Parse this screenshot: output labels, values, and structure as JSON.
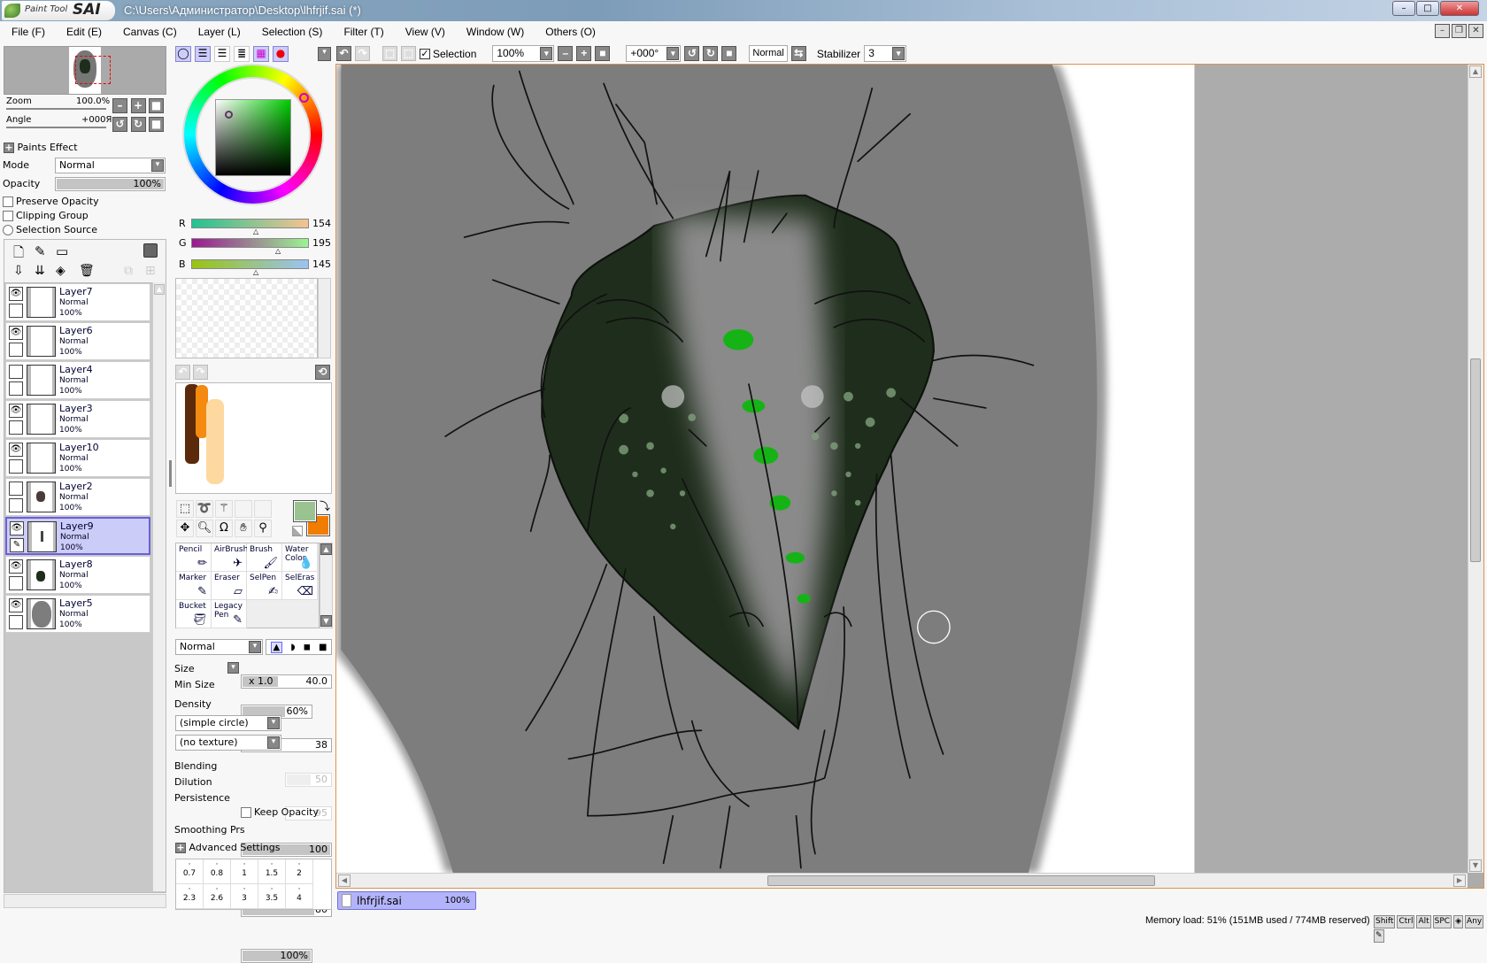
{
  "window": {
    "app_name": "SAI",
    "app_prefix": "Paint Tool",
    "title": "C:\\Users\\Администратор\\Desktop\\lhfrjif.sai (*)",
    "minimize": "–",
    "maximize": "□",
    "close": "✕"
  },
  "menu": [
    "File (F)",
    "Edit (E)",
    "Canvas (C)",
    "Layer (L)",
    "Selection (S)",
    "Filter (T)",
    "View (V)",
    "Window (W)",
    "Others (O)"
  ],
  "navigator": {
    "zoom_label": "Zoom",
    "zoom_value": "100.0%",
    "angle_label": "Angle",
    "angle_value": "+000Я"
  },
  "layer_props": {
    "paints_effect": "Paints Effect",
    "mode_label": "Mode",
    "mode_value": "Normal",
    "opacity_label": "Opacity",
    "opacity_value": "100%",
    "preserve_opacity": "Preserve Opacity",
    "clipping_group": "Clipping Group",
    "selection_source": "Selection Source"
  },
  "layers": [
    {
      "name": "Layer7",
      "mode": "Normal",
      "opacity": "100%",
      "visible": true
    },
    {
      "name": "Layer6",
      "mode": "Normal",
      "opacity": "100%",
      "visible": true
    },
    {
      "name": "Layer4",
      "mode": "Normal",
      "opacity": "100%",
      "visible": false
    },
    {
      "name": "Layer3",
      "mode": "Normal",
      "opacity": "100%",
      "visible": true
    },
    {
      "name": "Layer10",
      "mode": "Normal",
      "opacity": "100%",
      "visible": true
    },
    {
      "name": "Layer2",
      "mode": "Normal",
      "opacity": "100%",
      "visible": false
    },
    {
      "name": "Layer9",
      "mode": "Normal",
      "opacity": "100%",
      "visible": true,
      "selected": true
    },
    {
      "name": "Layer8",
      "mode": "Normal",
      "opacity": "100%",
      "visible": true
    },
    {
      "name": "Layer5",
      "mode": "Normal",
      "opacity": "100%",
      "visible": true
    }
  ],
  "color": {
    "r_label": "R",
    "r": "154",
    "g_label": "G",
    "g": "195",
    "b_label": "B",
    "b": "145",
    "primary": "#9ac391",
    "secondary": "#f07c00"
  },
  "tools": [
    {
      "label": "Pencil",
      "icon": "pencil-icon"
    },
    {
      "label": "AirBrush",
      "icon": "airbrush-icon"
    },
    {
      "label": "Brush",
      "icon": "brush-icon"
    },
    {
      "label": "Water Color",
      "icon": "watercolor-icon"
    },
    {
      "label": "Marker",
      "icon": "marker-icon"
    },
    {
      "label": "Eraser",
      "icon": "eraser-icon"
    },
    {
      "label": "SelPen",
      "icon": "selpen-icon"
    },
    {
      "label": "SelEras",
      "icon": "seleras-icon"
    },
    {
      "label": "Bucket",
      "icon": "bucket-icon"
    },
    {
      "label": "Legacy Pen",
      "icon": "legacy-pen-icon"
    }
  ],
  "brush": {
    "blend_mode": "Normal",
    "size_label": "Size",
    "size_mult": "x 1.0",
    "size_value": "40.0",
    "min_size_label": "Min Size",
    "min_size_value": "60%",
    "density_label": "Density",
    "density_value": "38",
    "shape": "(simple circle)",
    "shape_value": "50",
    "texture": "(no texture)",
    "texture_value": "95",
    "blending_label": "Blending",
    "blending_value": "100",
    "dilution_label": "Dilution",
    "dilution_value": "100",
    "persistence_label": "Persistence",
    "persistence_value": "80",
    "keep_opacity": "Keep Opacity",
    "smoothing_label": "Smoothing Prs",
    "smoothing_value": "100%",
    "advanced": "Advanced Settings",
    "sizes_row1": [
      "0.7",
      "0.8",
      "1",
      "1.5",
      "2"
    ],
    "sizes_row2": [
      "2.3",
      "2.6",
      "3",
      "3.5",
      "4"
    ]
  },
  "canvas_toolbar": {
    "selection_label": "Selection",
    "zoom": "100%",
    "angle": "+000°",
    "mode": "Normal",
    "stabilizer_label": "Stabilizer",
    "stabilizer_value": "3"
  },
  "file_tab": {
    "name": "lhfrjif.sai",
    "zoom": "100%"
  },
  "status": {
    "memory": "Memory load: 51% (151MB used / 774MB reserved)",
    "keys": [
      "Shift",
      "Ctrl",
      "Alt",
      "SPC",
      "◈",
      "Any",
      "✎"
    ]
  }
}
